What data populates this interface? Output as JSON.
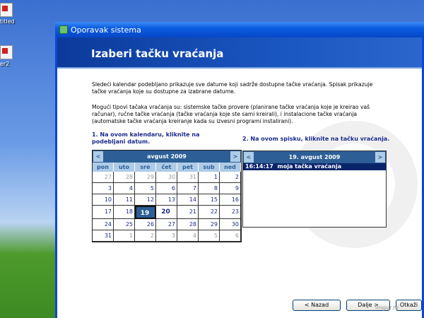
{
  "desktop": {
    "icons": [
      {
        "label": "titled"
      },
      {
        "label": "er2"
      }
    ]
  },
  "window": {
    "title": "Oporavak sistema",
    "heading": "Izaberi tačku vraćanja"
  },
  "intro": "Sledeći kalendar podebljano prikazuje sve datume koji sadrže dostupne tačke vraćanja. Spisak prikazuje tačke vraćanja koje su dostupne za izabrane datume.",
  "types": "Mogući tipovi tačaka vraćanja su: sistemske tačke provere (planirane tačke vraćanja koje je kreirao vaš računar), ručne tačke vraćanja (tačke vraćanja koje ste sami kreirali), i instalacione tačke vraćanja (automatske tačke vraćanja kreiranje kada su izvesni programi instalirani).",
  "step1": "1. Na ovom kalendaru, kliknite na podebljani datum.",
  "step2": "2. Na ovom spisku, kliknite na tačku vraćanja.",
  "calendar": {
    "month": "avgust 2009",
    "prev": "<",
    "next": ">",
    "days": [
      "pon",
      "uto",
      "sre",
      "čet",
      "pet",
      "sub",
      "ned"
    ],
    "weeks": [
      [
        "27",
        "28",
        "29",
        "30",
        "31",
        "1",
        "2"
      ],
      [
        "3",
        "4",
        "5",
        "6",
        "7",
        "8",
        "9"
      ],
      [
        "10",
        "11",
        "12",
        "13",
        "14",
        "15",
        "16"
      ],
      [
        "17",
        "18",
        "19",
        "20",
        "21",
        "22",
        "23"
      ],
      [
        "24",
        "25",
        "26",
        "27",
        "28",
        "29",
        "30"
      ],
      [
        "31",
        "1",
        "2",
        "3",
        "4",
        "5",
        "6"
      ]
    ],
    "selected": "19",
    "bold": [
      "19",
      "20"
    ]
  },
  "list": {
    "date": "19. avgust 2009",
    "prev": "<",
    "next": ">",
    "items": [
      {
        "time": "16:14:17",
        "name": "moja tačka vraćanja"
      }
    ]
  },
  "buttons": {
    "back": "< Nazad",
    "next": "Dalje >",
    "cancel": "Otkaži"
  },
  "watermark": "imgur.hr"
}
